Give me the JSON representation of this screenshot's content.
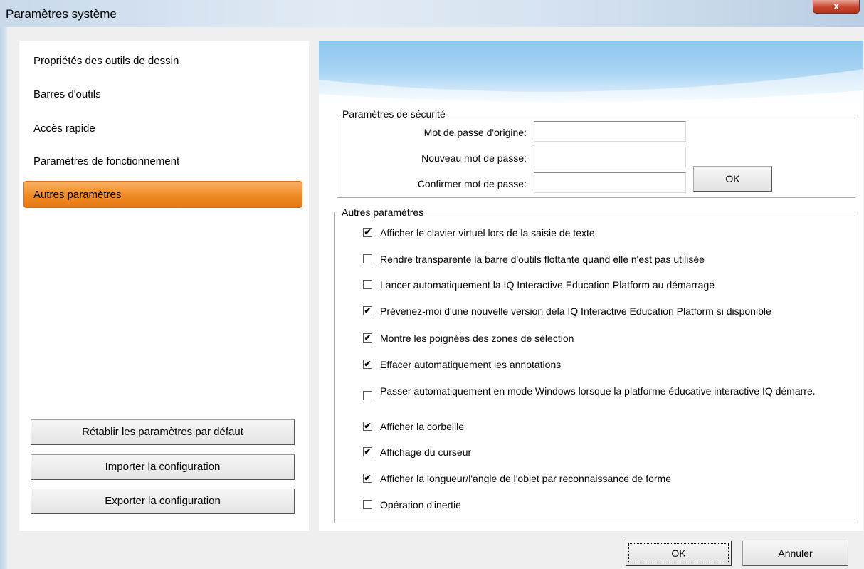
{
  "window": {
    "title": "Paramètres système",
    "close_label": "x"
  },
  "sidebar": {
    "items": [
      {
        "label": "Propriétés des outils de dessin"
      },
      {
        "label": "Barres d'outils"
      },
      {
        "label": "Accès rapide"
      },
      {
        "label": "Paramètres de fonctionnement"
      },
      {
        "label": "Autres paramètres",
        "selected": true
      }
    ],
    "buttons": {
      "reset": "Rétablir les paramètres par défaut",
      "import": "Importer la configuration",
      "export": "Exporter la configuration"
    }
  },
  "security": {
    "group_title": "Paramètres de sécurité",
    "original_password_label": "Mot de passe d'origine:",
    "new_password_label": "Nouveau mot de passe:",
    "confirm_password_label": "Confirmer mot de passe:",
    "original_password_value": "",
    "new_password_value": "",
    "confirm_password_value": "",
    "ok_label": "OK"
  },
  "other": {
    "group_title": "Autres paramètres",
    "options": [
      {
        "label": "Afficher le clavier virtuel lors de la saisie de texte",
        "checked": true
      },
      {
        "label": "Rendre transparente la barre d'outils flottante quand elle n'est pas utilisée",
        "checked": false
      },
      {
        "label": "Lancer automatiquement la IQ Interactive Education Platform au démarrage",
        "checked": false
      },
      {
        "label": "Prévenez-moi d'une nouvelle version dela IQ Interactive Education Platform si disponible",
        "checked": true
      },
      {
        "label": "Montre les poignées des zones de sélection",
        "checked": true
      },
      {
        "label": "Effacer automatiquement les annotations",
        "checked": true
      },
      {
        "label": "Passer automatiquement en mode Windows lorsque la platforme éducative interactive IQ démarre.",
        "checked": false
      },
      {
        "label": "Afficher la corbeille",
        "checked": true
      },
      {
        "label": "Affichage du curseur",
        "checked": true
      },
      {
        "label": "Afficher la longueur/l'angle de l'objet par reconnaissance de forme",
        "checked": true
      },
      {
        "label": "Opération d'inertie",
        "checked": false
      }
    ]
  },
  "footer": {
    "ok_label": "OK",
    "cancel_label": "Annuler"
  },
  "colors": {
    "selected_item": "#f08a24",
    "banner": "#8fc6ef",
    "close_button": "#c9452c"
  }
}
